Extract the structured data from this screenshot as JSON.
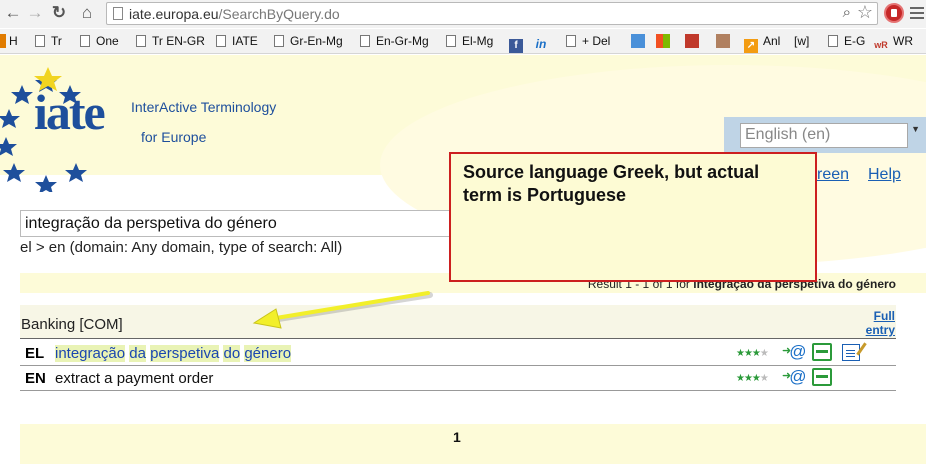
{
  "browser": {
    "url_host": "iate.europa.eu",
    "url_path": "/SearchByQuery.do",
    "bookmarks": [
      {
        "label": "H"
      },
      {
        "label": "Tr"
      },
      {
        "label": "One"
      },
      {
        "label": "Tr EN-GR"
      },
      {
        "label": "IATE"
      },
      {
        "label": "Gr-En-Mg"
      },
      {
        "label": "En-Gr-Mg"
      },
      {
        "label": "El-Mg"
      },
      {
        "label": "+ Del"
      },
      {
        "label": "Anl"
      },
      {
        "label": "[w]"
      },
      {
        "label": "E-G"
      },
      {
        "label": "WR"
      }
    ]
  },
  "header": {
    "logo_text": "iate",
    "brand_line1": "InterActive Terminology",
    "brand_line2": "for Europe",
    "language_select": "English (en)",
    "link_screen": "reen",
    "link_help": "Help"
  },
  "search": {
    "query": "integração da perspetiva do género",
    "info": "el > en (domain: Any domain, type of search: All)"
  },
  "results": {
    "summary_prefix": "Result 1 - 1 of 1 for",
    "summary_term": "integração da perspetiva do género",
    "domain": "Banking [COM]",
    "full_entry": "Full entry",
    "rows": [
      {
        "lang": "EL",
        "words": [
          "integração",
          "da",
          "perspetiva",
          "do",
          "género"
        ],
        "reliability": 3
      },
      {
        "lang": "EN",
        "text": "extract a payment order",
        "reliability": 3
      }
    ],
    "page": "1"
  },
  "annotation": {
    "callout_text": "Source language Greek, but actual term is Portuguese",
    "arrow_color": "#f2ef2a",
    "box_border": "#cc1f1f"
  }
}
